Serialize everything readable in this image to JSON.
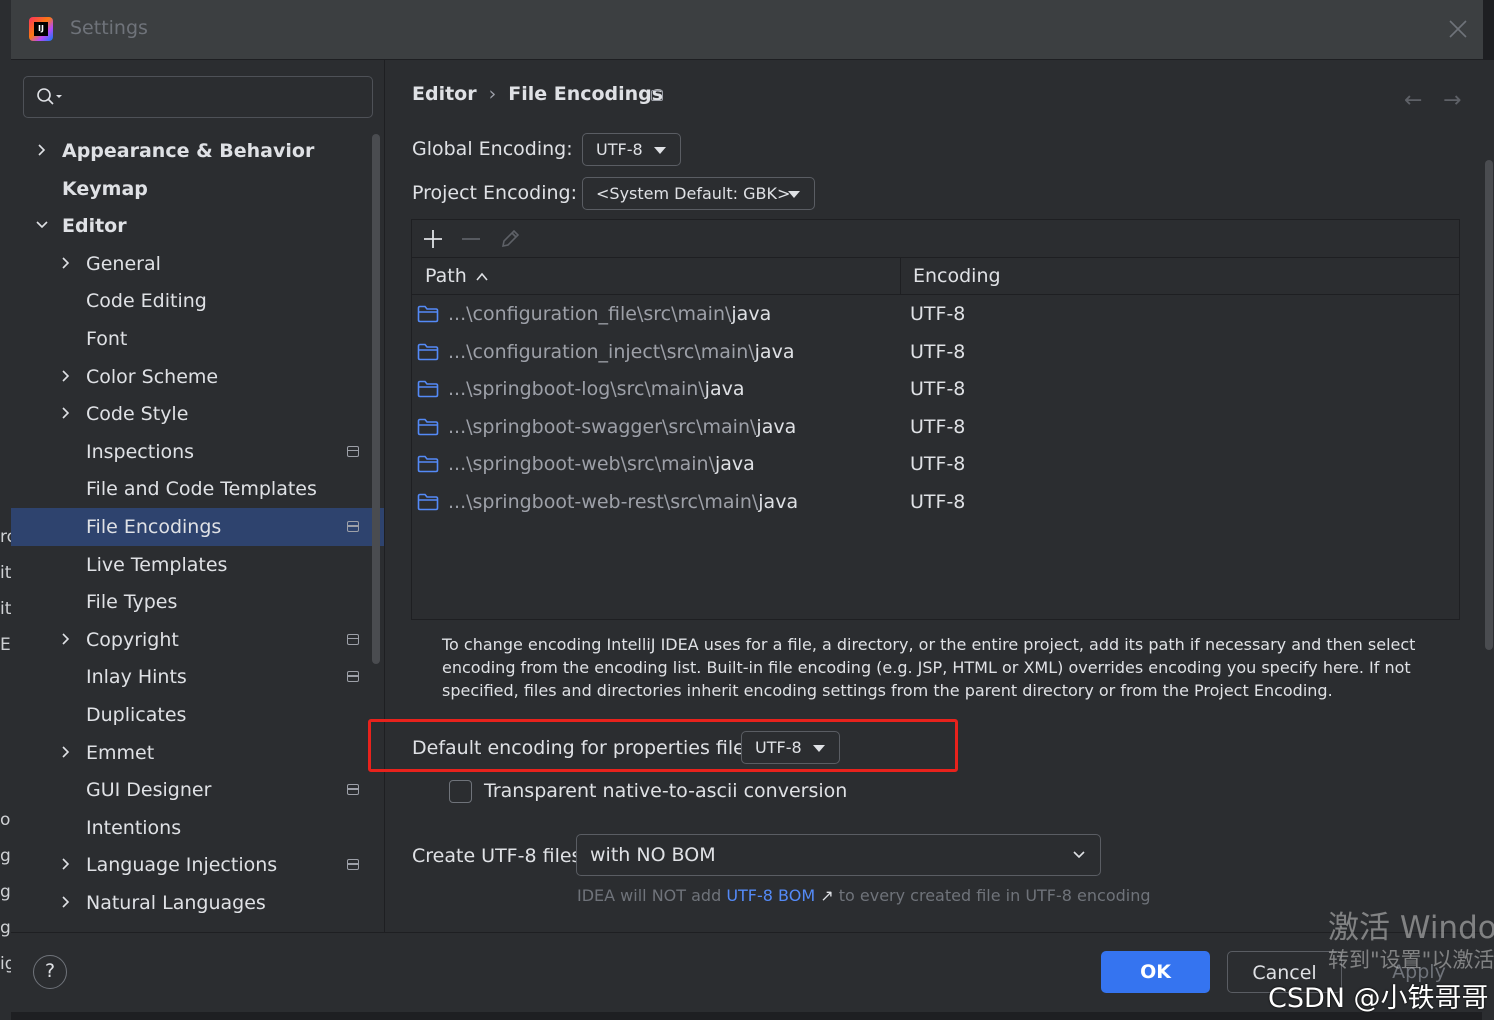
{
  "window": {
    "title": "Settings",
    "logo_text": "IJ"
  },
  "search": {
    "placeholder": ""
  },
  "sidebar": {
    "items": [
      {
        "label": "Appearance & Behavior",
        "level": 0,
        "bold": true,
        "expandable": true,
        "expanded": false,
        "page_icon": false
      },
      {
        "label": "Keymap",
        "level": 0,
        "bold": true,
        "expandable": false,
        "page_icon": false
      },
      {
        "label": "Editor",
        "level": 0,
        "bold": true,
        "expandable": true,
        "expanded": true,
        "page_icon": false
      },
      {
        "label": "General",
        "level": 1,
        "expandable": true,
        "expanded": false,
        "page_icon": false
      },
      {
        "label": "Code Editing",
        "level": 1,
        "expandable": false,
        "page_icon": false
      },
      {
        "label": "Font",
        "level": 1,
        "expandable": false,
        "page_icon": false
      },
      {
        "label": "Color Scheme",
        "level": 1,
        "expandable": true,
        "expanded": false,
        "page_icon": false
      },
      {
        "label": "Code Style",
        "level": 1,
        "expandable": true,
        "expanded": false,
        "page_icon": false
      },
      {
        "label": "Inspections",
        "level": 1,
        "expandable": false,
        "page_icon": true
      },
      {
        "label": "File and Code Templates",
        "level": 1,
        "expandable": false,
        "page_icon": false
      },
      {
        "label": "File Encodings",
        "level": 1,
        "expandable": false,
        "page_icon": true,
        "selected": true
      },
      {
        "label": "Live Templates",
        "level": 1,
        "expandable": false,
        "page_icon": false
      },
      {
        "label": "File Types",
        "level": 1,
        "expandable": false,
        "page_icon": false
      },
      {
        "label": "Copyright",
        "level": 1,
        "expandable": true,
        "expanded": false,
        "page_icon": true
      },
      {
        "label": "Inlay Hints",
        "level": 1,
        "expandable": false,
        "page_icon": true
      },
      {
        "label": "Duplicates",
        "level": 1,
        "expandable": false,
        "page_icon": false
      },
      {
        "label": "Emmet",
        "level": 1,
        "expandable": true,
        "expanded": false,
        "page_icon": false
      },
      {
        "label": "GUI Designer",
        "level": 1,
        "expandable": false,
        "page_icon": true
      },
      {
        "label": "Intentions",
        "level": 1,
        "expandable": false,
        "page_icon": false
      },
      {
        "label": "Language Injections",
        "level": 1,
        "expandable": true,
        "expanded": false,
        "page_icon": true
      },
      {
        "label": "Natural Languages",
        "level": 1,
        "expandable": true,
        "expanded": false,
        "page_icon": false
      }
    ]
  },
  "breadcrumb": {
    "parent": "Editor",
    "separator": "›",
    "current": "File Encodings"
  },
  "nav": {
    "back": "←",
    "forward": "→"
  },
  "global_encoding": {
    "label": "Global Encoding:",
    "value": "UTF-8"
  },
  "project_encoding": {
    "label": "Project Encoding:",
    "value": "<System Default: GBK>"
  },
  "table": {
    "toolbar": {
      "add": "add-icon",
      "remove": "remove-icon",
      "edit": "edit-icon"
    },
    "columns": {
      "path": "Path",
      "encoding": "Encoding"
    },
    "rows": [
      {
        "path_dim": "...\\configuration_file\\src\\main\\",
        "path_end": "java",
        "encoding": "UTF-8"
      },
      {
        "path_dim": "...\\configuration_inject\\src\\main\\",
        "path_end": "java",
        "encoding": "UTF-8"
      },
      {
        "path_dim": "...\\springboot-log\\src\\main\\",
        "path_end": "java",
        "encoding": "UTF-8"
      },
      {
        "path_dim": "...\\springboot-swagger\\src\\main\\",
        "path_end": "java",
        "encoding": "UTF-8"
      },
      {
        "path_dim": "...\\springboot-web\\src\\main\\",
        "path_end": "java",
        "encoding": "UTF-8"
      },
      {
        "path_dim": "...\\springboot-web-rest\\src\\main\\",
        "path_end": "java",
        "encoding": "UTF-8"
      }
    ]
  },
  "help_text": "To change encoding IntelliJ IDEA uses for a file, a directory, or the entire project, add its path if necessary and then select encoding from the encoding list. Built-in file encoding (e.g. JSP, HTML or XML) overrides encoding you specify here. If not specified, files and directories inherit encoding settings from the parent directory or from the Project Encoding.",
  "properties_encoding": {
    "label": "Default encoding for properties files:",
    "value": "UTF-8"
  },
  "native_to_ascii": {
    "label": "Transparent native-to-ascii conversion",
    "checked": false
  },
  "create_utf8": {
    "label": "Create UTF-8 files:",
    "value": "with NO BOM"
  },
  "bom_hint": {
    "prefix": "IDEA will NOT add ",
    "link": "UTF-8 BOM",
    "link_arrow": "↗",
    "suffix": " to every created file in UTF-8 encoding"
  },
  "footer": {
    "help": "?",
    "ok": "OK",
    "cancel": "Cancel",
    "apply": "Apply"
  },
  "watermark": {
    "activate_line1": "激活 Windo",
    "activate_line2": "转到\"设置\"以激活",
    "csdn": "CSDN @小铁哥哥"
  },
  "background_letters": [
    "ro",
    "it",
    "it",
    "El",
    "o",
    "g",
    "g",
    "g",
    "ig"
  ],
  "colors": {
    "accent": "#3574f0",
    "selection": "#2e436e",
    "highlight_box": "#e8221c",
    "link": "#548af7",
    "folder": "#548af7"
  }
}
